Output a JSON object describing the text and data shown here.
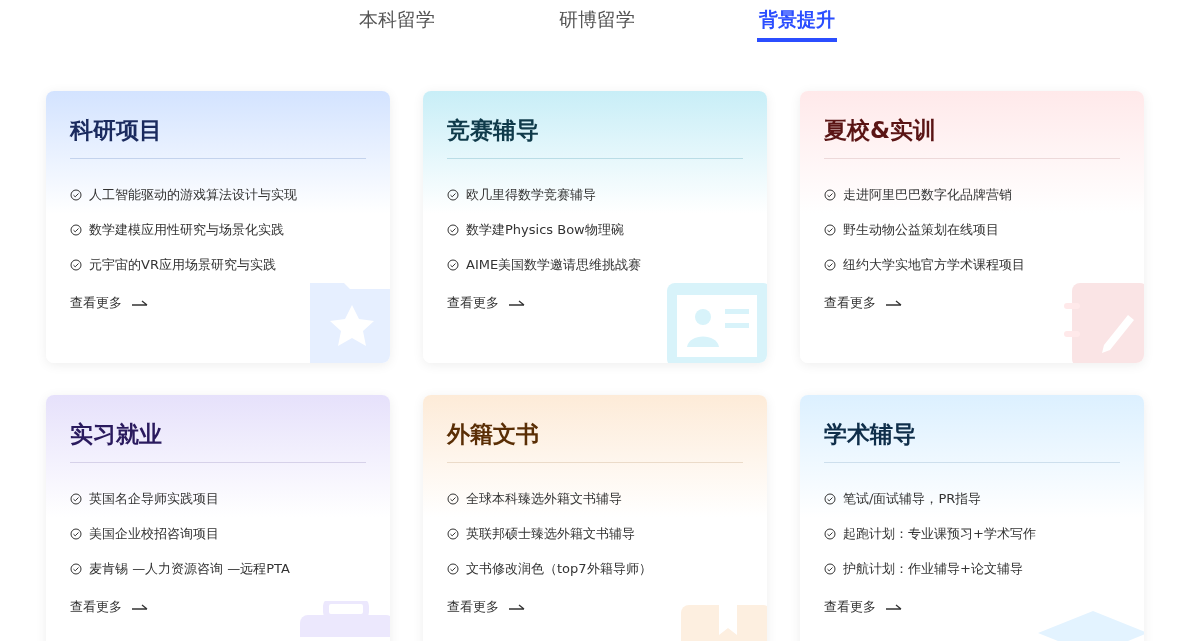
{
  "tabs": [
    {
      "label": "本科留学",
      "selected": false
    },
    {
      "label": "研博留学",
      "selected": false
    },
    {
      "label": "背景提升",
      "selected": true
    }
  ],
  "cards": [
    {
      "kind": "research",
      "color": "#d3e3ff",
      "title": "科研项目",
      "items": [
        "人工智能驱动的游戏算法设计与实现",
        "数学建模应用性研究与场景化实践",
        "元宇宙的VR应用场景研究与实践"
      ],
      "more": "查看更多"
    },
    {
      "kind": "competition",
      "color": "#c8eef7",
      "title": "竞赛辅导",
      "items": [
        "欧几里得数学竞赛辅导",
        "数学建Physics Bow物理碗",
        "AIME美国数学邀请思维挑战赛"
      ],
      "more": "查看更多"
    },
    {
      "kind": "summer",
      "color": "#ffe9ea",
      "title": "夏校&实训",
      "items": [
        "走进阿里巴巴数字化品牌营销",
        "野生动物公益策划在线项目",
        "纽约大学实地官方学术课程项目"
      ],
      "more": "查看更多"
    },
    {
      "kind": "internship",
      "color": "#e6e1fb",
      "title": "实习就业",
      "items": [
        "英国名企导师实践项目",
        "美国企业校招咨询项目",
        "麦肯锡 —人力资源咨询 —远程PTA"
      ],
      "more": "查看更多"
    },
    {
      "kind": "documents",
      "color": "#fdebd8",
      "title": "外籍文书",
      "items": [
        "全球本科臻选外籍文书辅导",
        "英联邦硕士臻选外籍文书辅导",
        "文书修改润色（top7外籍导师）"
      ],
      "more": "查看更多"
    },
    {
      "kind": "tutoring",
      "color": "#dcf0ff",
      "title": "学术辅导",
      "items": [
        "笔试/面试辅导，PR指导",
        "起跑计划：专业课预习+学术写作",
        "护航计划：作业辅导+论文辅导"
      ],
      "more": "查看更多"
    }
  ]
}
